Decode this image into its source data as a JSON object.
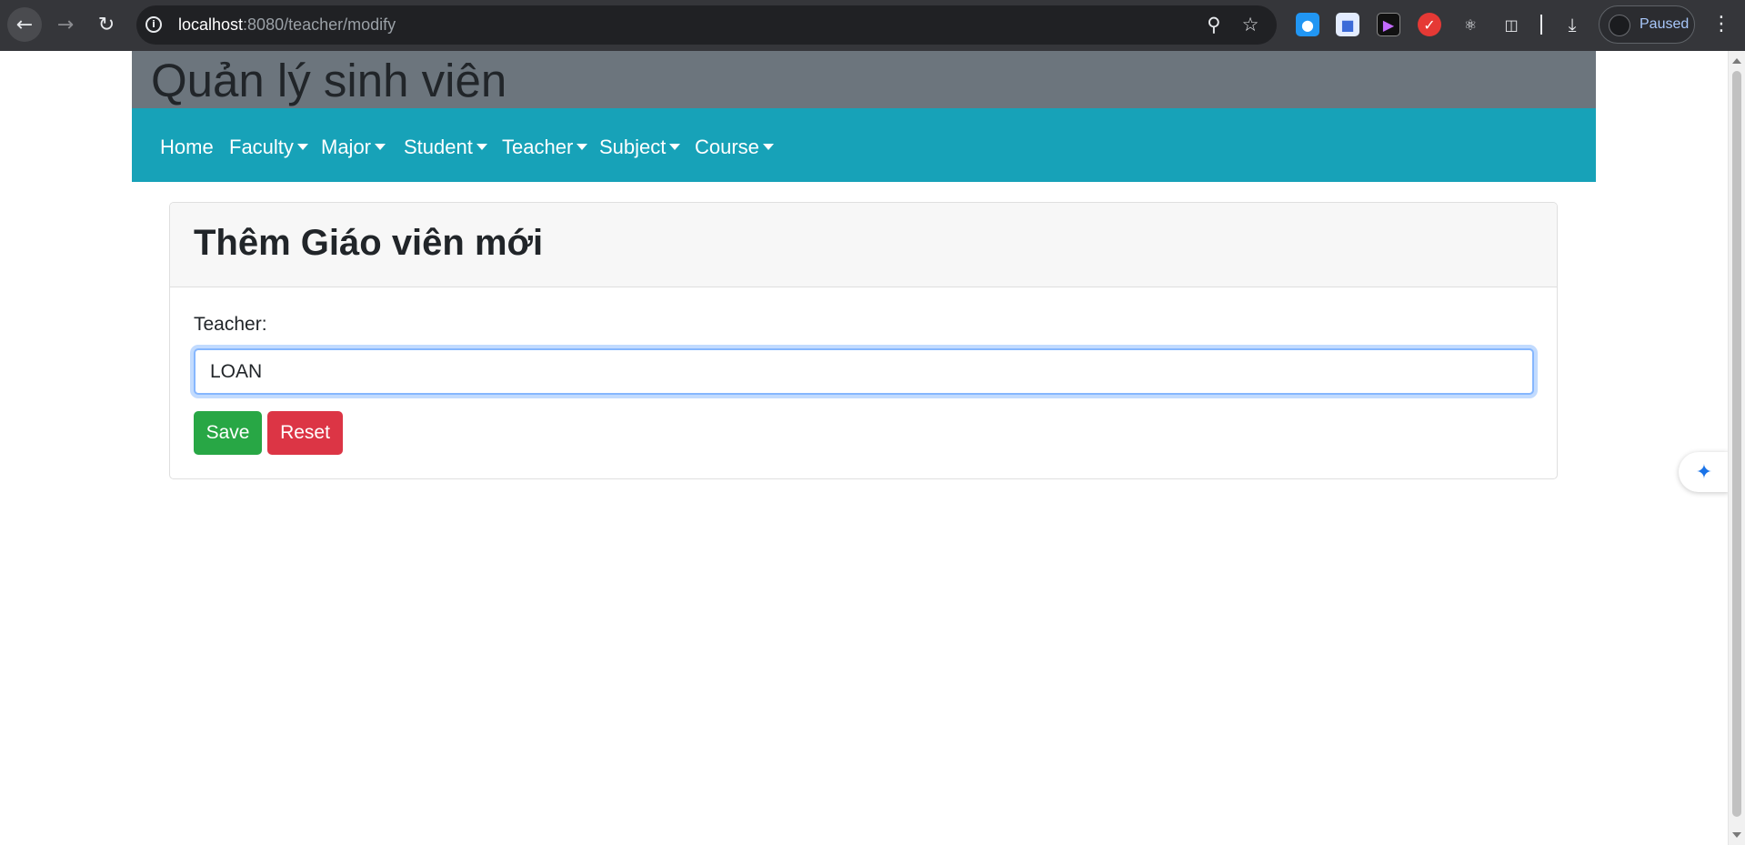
{
  "browser": {
    "url_host": "localhost",
    "url_path": ":8080/teacher/modify",
    "profile_status": "Paused"
  },
  "app": {
    "title": "Quản lý sinh viên"
  },
  "navbar": {
    "items": [
      {
        "label": "Home",
        "dropdown": false
      },
      {
        "label": "Faculty",
        "dropdown": true
      },
      {
        "label": "Major",
        "dropdown": true
      },
      {
        "label": "Student",
        "dropdown": true
      },
      {
        "label": "Teacher",
        "dropdown": true
      },
      {
        "label": "Subject",
        "dropdown": true
      },
      {
        "label": "Course",
        "dropdown": true
      }
    ]
  },
  "form": {
    "heading": "Thêm Giáo viên mới",
    "teacher_label": "Teacher:",
    "teacher_value": "LOAN",
    "save_label": "Save",
    "reset_label": "Reset"
  },
  "colors": {
    "header_bg": "#6c757d",
    "navbar_bg": "#17a2b8",
    "save_btn": "#28a745",
    "reset_btn": "#dc3545"
  }
}
